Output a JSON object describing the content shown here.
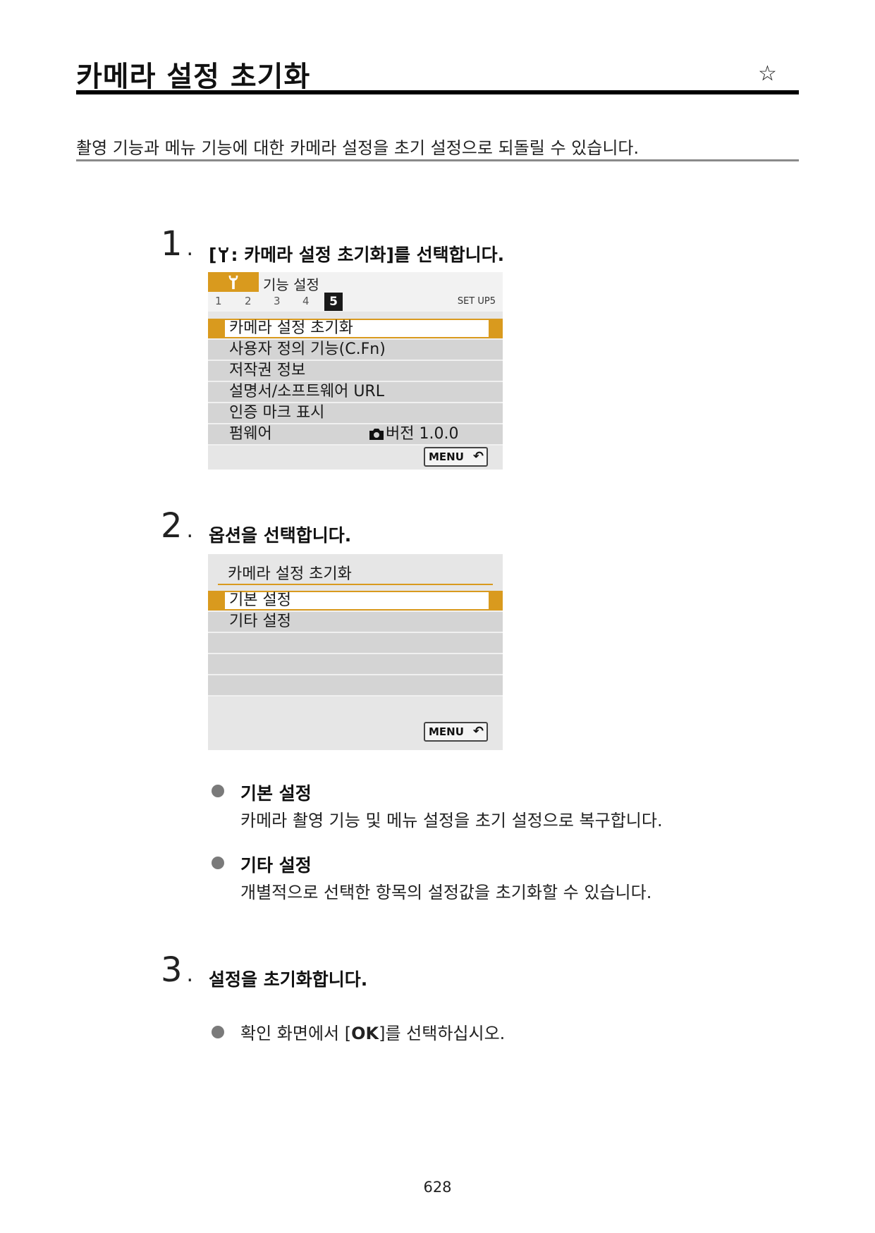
{
  "header": {
    "title": "카메라 설정 초기화",
    "star": "☆"
  },
  "intro": "촬영 기능과 메뉴 기능에 대한 카메라 설정을 초기 설정으로 되돌릴 수 있습니다.",
  "steps": [
    {
      "number": "1",
      "text_prefix": "[",
      "text_suffix": ": 카메라 설정 초기화]를 선택합니다.",
      "screen": {
        "tab_title": "기능 설정",
        "tab_numbers": [
          "1",
          "2",
          "3",
          "4",
          "5"
        ],
        "active_tab": "5",
        "setup_label": "SET UP5",
        "items": [
          "카메라 설정 초기화",
          "사용자 정의 기능(C.Fn)",
          "저작권 정보",
          "설명서/소프트웨어 URL",
          "인증 마크 표시",
          "펌웨어"
        ],
        "firmware_version": "버전 1.0.0",
        "menu_button": "MENU"
      }
    },
    {
      "number": "2",
      "text": "옵션을 선택합니다.",
      "screen": {
        "title": "카메라 설정 초기화",
        "items": [
          "기본 설정",
          "기타 설정"
        ],
        "menu_button": "MENU"
      },
      "bullets": [
        {
          "title": "기본 설정",
          "desc": "카메라 촬영 기능 및 메뉴 설정을 초기 설정으로 복구합니다."
        },
        {
          "title": "기타 설정",
          "desc": "개별적으로 선택한 항목의 설정값을 초기화할 수 있습니다."
        }
      ]
    },
    {
      "number": "3",
      "text": "설정을 초기화합니다.",
      "bullet": {
        "prefix": "확인 화면에서 [",
        "ok": "OK",
        "suffix": "]를 선택하십시오."
      }
    }
  ],
  "page_number": "628",
  "colors": {
    "accent": "#d99a1e",
    "screen_bg": "#e6e6e6",
    "row_bg": "#d4d4d4"
  }
}
